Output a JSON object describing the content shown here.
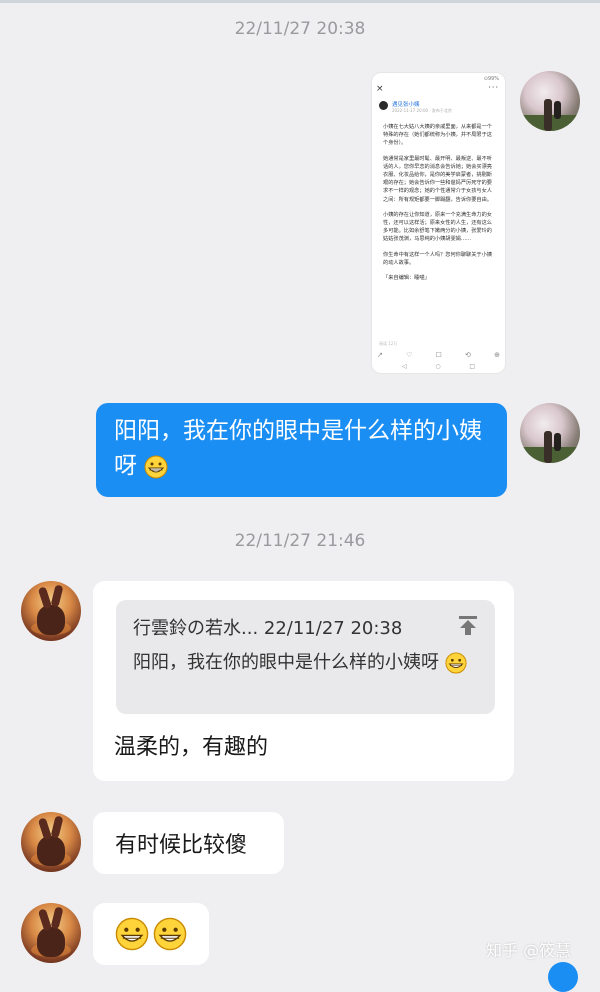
{
  "timestamps": [
    "22/11/27 20:38",
    "22/11/27 21:46"
  ],
  "screenshot": {
    "status": "⊙99%",
    "close": "×",
    "more": "···",
    "author": "遇见张小姨",
    "meta": "2022-11-17 20:00 · 发布于北京",
    "paragraphs": [
      "小姨在七大姑八大姨的亲戚里面，从来都是一个特殊的存在（她们都统称为小姨，并不局限于这个身份）。",
      "她通常是家里最时髦、最开明、最叛逆、最不听话的人，您你早恋的消息会告诉她；她会买漂亮衣服、化妆品给你，是你的美学启蒙者，挑剔斯艰的存在；她会告诉你一些和爸妈严厉死守的要求不一样的观念；她的个性通常介于女孩与女人之间：所有规矩都要一脚踢翻，告诉你要自由。",
      "小姨的存在让你知道，原来一个充满生命力的女性，还可以这样活；原来女性的人生，还有这么多可能。比如余舒笔下嫩两分的小姨，张爱玲的姑姑张茂渊，马思纯的小姨胡雯娟……",
      "你生命中有这样一个人吗？您何你聊聊关于小姨的动人故事。",
      "「来自编辑：睡喵」"
    ],
    "count": "阅读 12万",
    "toolbar": [
      "↗",
      "♡",
      "☐",
      "⟲",
      "⊕"
    ],
    "nav": [
      "◁",
      "○",
      "□"
    ]
  },
  "messages": {
    "outgoing_text": "阳阳，我在你的眼中是什么样的小姨呀",
    "quote_header": "行雲鈴の若水... 22/11/27 20:38",
    "quote_body": "阳阳，我在你的眼中是什么样的小姨呀",
    "reply1": "温柔的，有趣的",
    "reply2": "有时候比较傻"
  },
  "emoji": "grinning-face",
  "watermark": "知乎 @筱慧",
  "colors": {
    "bubble_blue": "#1b8ef3",
    "background": "#efeff1"
  }
}
